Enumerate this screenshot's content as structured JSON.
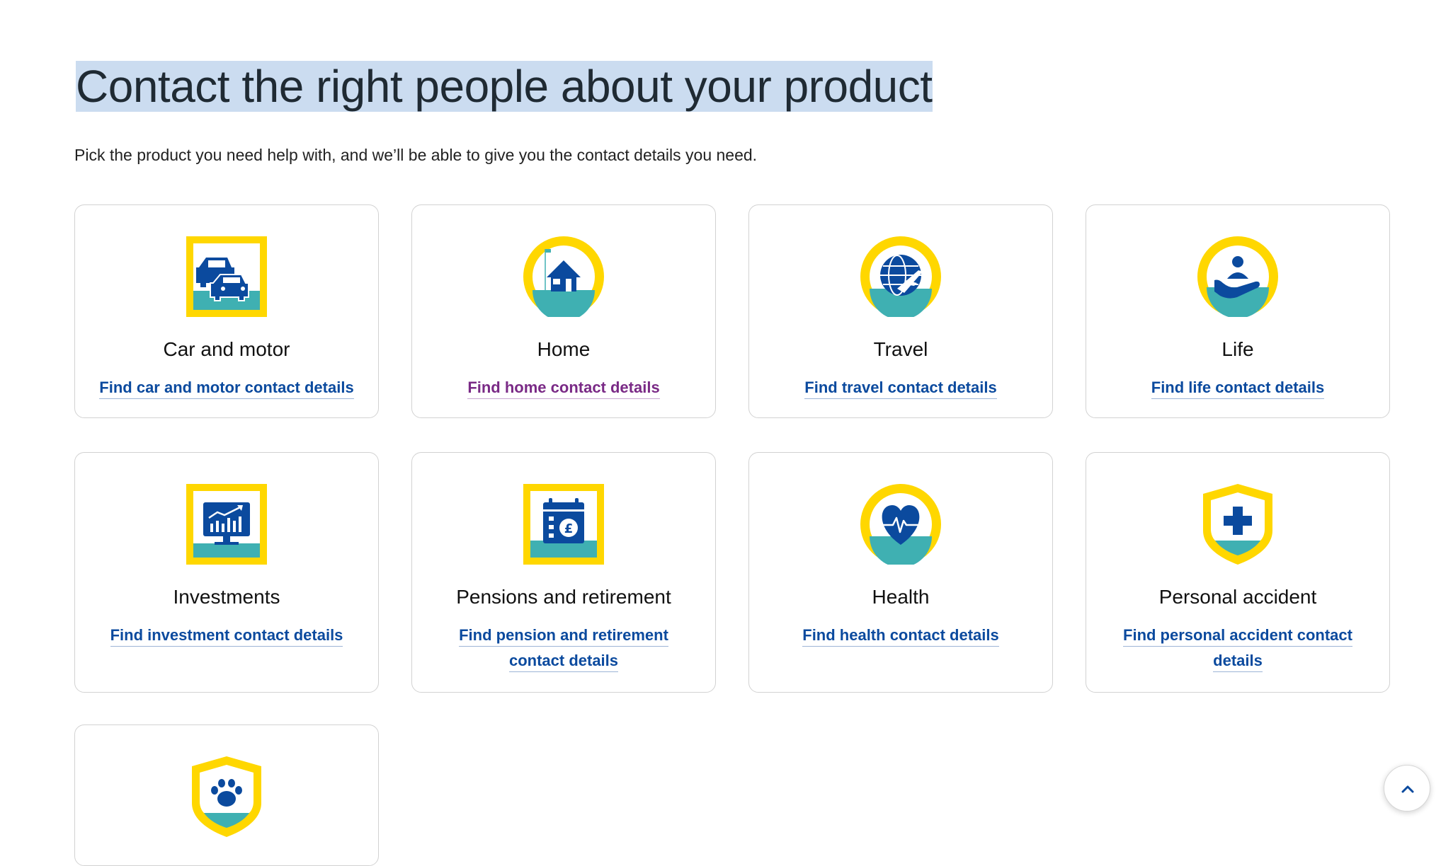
{
  "page": {
    "title": "Contact the right people about your product",
    "subtitle": "Pick the product you need help with, and we’ll be able to give you the contact details you need."
  },
  "colors": {
    "brand_yellow": "#ffd700",
    "brand_blue": "#0b4a9e",
    "teal": "#3fb0b2",
    "visited_link": "#7a2a86",
    "title_highlight": "#cbdcf0"
  },
  "products": [
    {
      "name": "Car and motor",
      "link": "Find car and motor contact details",
      "icon": "car-icon"
    },
    {
      "name": "Home",
      "link": "Find home contact details",
      "icon": "house-icon",
      "visited": true
    },
    {
      "name": "Travel",
      "link": "Find travel contact details",
      "icon": "globe-plane-icon"
    },
    {
      "name": "Life",
      "link": "Find life contact details",
      "icon": "hand-person-icon"
    },
    {
      "name": "Investments",
      "link": "Find investment contact details",
      "icon": "chart-monitor-icon"
    },
    {
      "name": "Pensions and retirement",
      "link": "Find pension and retirement contact details",
      "icon": "calendar-pound-icon"
    },
    {
      "name": "Health",
      "link": "Find health contact details",
      "icon": "heart-pulse-icon"
    },
    {
      "name": "Personal accident",
      "link": "Find personal accident contact details",
      "icon": "shield-cross-icon"
    },
    {
      "icon": "shield-paw-icon"
    }
  ],
  "scroll_top": {
    "icon": "chevron-up-icon"
  }
}
